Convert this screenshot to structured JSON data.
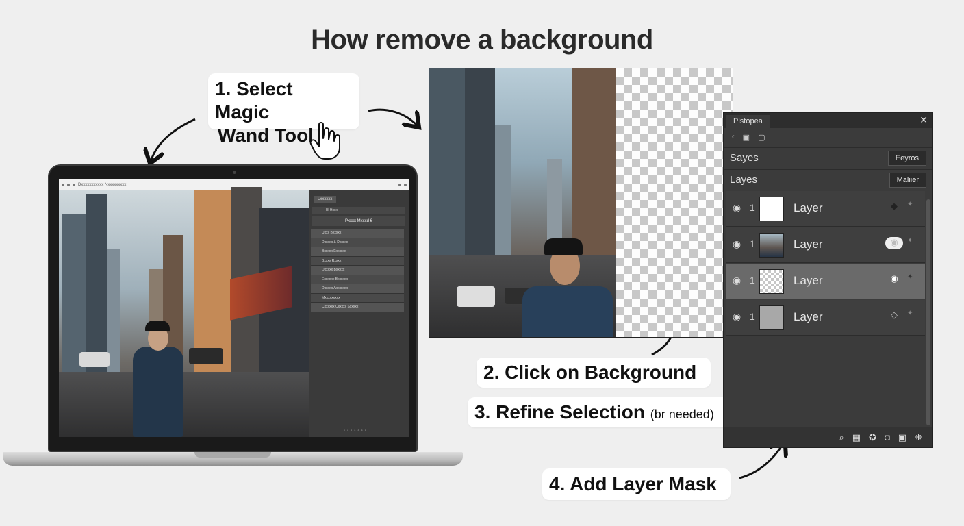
{
  "title": "How remove a background",
  "steps": {
    "s1_line1": "1. Select Magic",
    "s1_line2": "Wand Tool",
    "s2": "2. Click on Background",
    "s3": "3. Refine Selection",
    "s3_note": "(br needed)",
    "s4": "4. Add Layer Mask"
  },
  "laptop": {
    "browser_text": "Dxxxxxxxxxxx  Nxxxxxxxxx",
    "panel_tab": "Lxxxxxx",
    "panel_top": "Bl   Hxxx",
    "panel_header": "Pxxxx Mxxxd  6",
    "panel_rows": [
      "Uxxx Bxxxxx",
      "Dxxxxx & Dxxxxx",
      "Bxxxxx Exxxxxx",
      "Bxxxx Rxxxx",
      "Dxxxxx Bxxxxx",
      "Exxxxxx Bxxxxxx",
      "Dxxxxx Axxxxxxx",
      "Mxxxxxxxxx",
      "Cxxxxxx Cxxxxx Sxxxxx"
    ]
  },
  "panel": {
    "tab": "Plstopea",
    "close": "✕",
    "row1_label": "Sayes",
    "row1_button": "Eeyros",
    "row2_label": "Layes",
    "row2_button": "Maliier",
    "layers": [
      {
        "num": "1",
        "name": "Layer",
        "thumb": "white"
      },
      {
        "num": "1",
        "name": "Layer",
        "thumb": "photo"
      },
      {
        "num": "1",
        "name": "Layer",
        "thumb": "transparent"
      },
      {
        "num": "1",
        "name": "Layer",
        "thumb": "gray"
      }
    ],
    "icons": {
      "back": "back-chevron-icon",
      "save": "save-icon",
      "folder": "folder-icon",
      "eye": "eye-icon",
      "search": "search-icon",
      "mask": "layer-mask-icon"
    }
  },
  "colors": {
    "background": "#efefef",
    "panel_bg": "#3b3b3b",
    "panel_selected": "#6a6a6a"
  }
}
